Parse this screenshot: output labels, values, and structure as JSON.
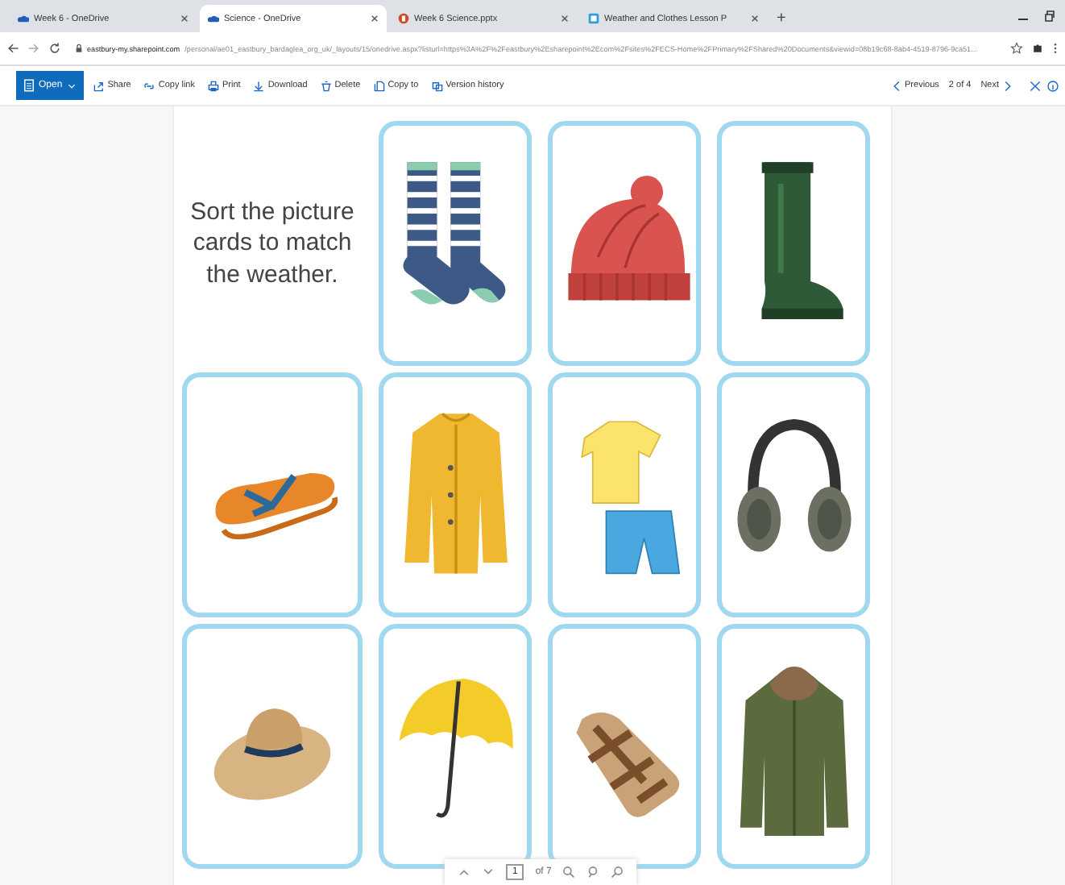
{
  "browser": {
    "tabs": [
      {
        "title": "Week 6 - OneDrive",
        "kind": "onedrive",
        "selected": false
      },
      {
        "title": "Science - OneDrive",
        "kind": "onedrive",
        "selected": true
      },
      {
        "title": "Week 6 Science.pptx",
        "kind": "powerpoint",
        "selected": false
      },
      {
        "title": "Weather and Clothes Lesson P",
        "kind": "document",
        "selected": false
      }
    ],
    "new_tab": "+",
    "address_host": "eastbury-my.sharepoint.com",
    "address_path": "/personal/ae01_eastbury_bardaglea_org_uk/_layouts/15/onedrive.aspx?listurl=https%3A%2F%2Feastbury%2Esharepoint%2Ecom%2Fsites%2FECS-Home%2FPrimary%2FShared%20Documents&viewid=08b19c68-8ab4-4519-8796-9ca51..."
  },
  "toolbar": {
    "open": "Open",
    "actions": [
      {
        "label": "Share",
        "kind": "share"
      },
      {
        "label": "Copy link",
        "kind": "link"
      },
      {
        "label": "Print",
        "kind": "print"
      },
      {
        "label": "Download",
        "kind": "download"
      },
      {
        "label": "Delete",
        "kind": "delete"
      },
      {
        "label": "Copy to",
        "kind": "copy"
      },
      {
        "label": "Version history",
        "kind": "history"
      }
    ],
    "previous": "Previous",
    "position": "2 of 4",
    "next": "Next"
  },
  "document": {
    "instruction": "Sort the picture cards to match the weather.",
    "cards": [
      {
        "kind": "socks"
      },
      {
        "kind": "beanie"
      },
      {
        "kind": "boot"
      },
      {
        "kind": "flipflops"
      },
      {
        "kind": "raincoat"
      },
      {
        "kind": "tshirt"
      },
      {
        "kind": "earmuffs"
      },
      {
        "kind": "sunhat"
      },
      {
        "kind": "umbrella"
      },
      {
        "kind": "sandals"
      },
      {
        "kind": "parka"
      }
    ]
  },
  "page_nav": {
    "page": "1",
    "total": "of 7"
  }
}
